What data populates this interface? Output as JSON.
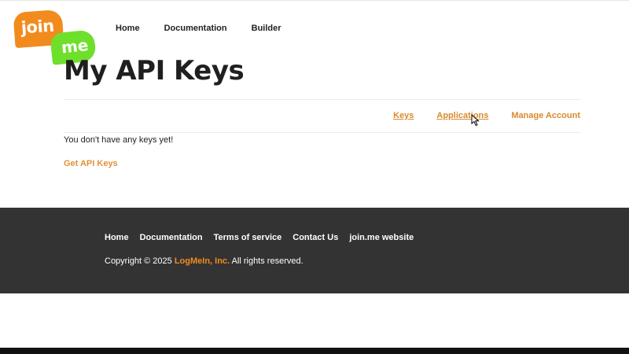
{
  "logo": {
    "part1": "join",
    "part2": "me"
  },
  "topnav": {
    "home": "Home",
    "documentation": "Documentation",
    "builder": "Builder"
  },
  "page": {
    "title": "My API Keys"
  },
  "subnav": {
    "keys": "Keys",
    "applications": "Applications",
    "manage_account": "Manage Account"
  },
  "content": {
    "empty_message": "You don't have any keys yet!",
    "get_keys_link": "Get API Keys"
  },
  "footer": {
    "links": [
      "Home",
      "Documentation",
      "Terms of service",
      "Contact Us",
      "join.me website"
    ],
    "copyright_prefix": "Copyright © 2025",
    "company": "LogMeIn, Inc.",
    "copyright_suffix": "All rights reserved."
  },
  "colors": {
    "orange": "#f28b1e",
    "green": "#6ee02c",
    "footer_bg": "#333333",
    "link_orange": "#d88a2d"
  }
}
